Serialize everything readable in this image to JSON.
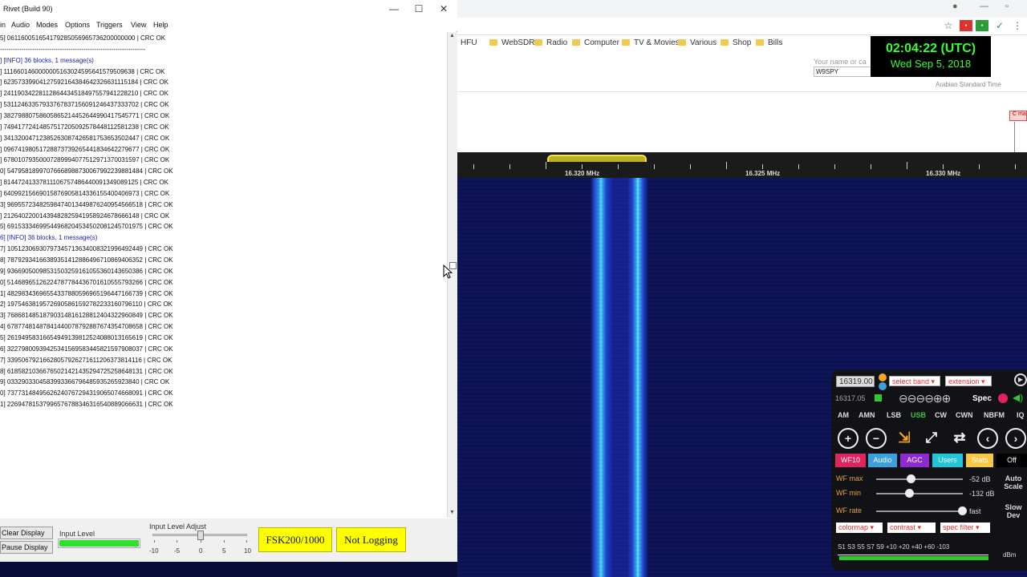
{
  "browser": {
    "bookmarks": [
      "HFU",
      "WebSDR",
      "Radio",
      "Computer",
      "TV & Movies",
      "Various",
      "Shop",
      "Bills"
    ],
    "name_label": "Your name or ca",
    "name_value": "W9SPY",
    "clock_time": "02:04:22 (UTC)",
    "clock_date": "Wed Sep 5, 2018",
    "timezone": "Arabian Standard Time",
    "c_button": "C ma",
    "freq_labels": [
      "16.320 MHz",
      "16.325 MHz",
      "16.330 MHz"
    ]
  },
  "panel": {
    "freq": "16319.00",
    "select_band": "select band",
    "extension": "extension",
    "sub_freq": "16317.05",
    "spec": "Spec",
    "modes": [
      "AM",
      "AMN",
      "LSB",
      "USB",
      "CW",
      "CWN",
      "NBFM",
      "IQ"
    ],
    "active_mode": "USB",
    "tags": {
      "wf10": "WF10",
      "audio": "Audio",
      "agc": "AGC",
      "users": "Users",
      "stats": "Stats",
      "off": "Off"
    },
    "wf_max": {
      "label": "WF max",
      "value": "-52 dB",
      "level": 0.4
    },
    "wf_min": {
      "label": "WF min",
      "value": "-132 dB",
      "level": 0.38
    },
    "wf_rate": {
      "label": "WF rate",
      "value": "fast",
      "level": 0.99
    },
    "auto_scale": [
      "Auto",
      "Scale"
    ],
    "slow_dev": [
      "Slow",
      "Dev"
    ],
    "colormap": "colormap",
    "contrast": "contrast",
    "spec_filter": "spec filter",
    "smeter_labels": "S1   S3   S5   S7   S9  +10 +20      +40      +60  -103",
    "smeter_unit": "dBm"
  },
  "rivet": {
    "title": "Rivet (Build 90)",
    "menu": [
      "in",
      "Audio",
      "Modes",
      "Options",
      "Triggers",
      "View",
      "Help"
    ],
    "log_lines": [
      {
        "text": "5] 061160051654179285056965736200000000 | CRC OK",
        "kind": "data"
      },
      {
        "text": "--------------------------------------------------------------------",
        "kind": "dash"
      },
      {
        "text": "] [INFO] 36 blocks, 1 message(s)",
        "kind": "info"
      },
      {
        "text": "] 111660146000000516302459564157950963​8 | CRC OK",
        "kind": "data"
      },
      {
        "text": "] 623573399041275921643846423266311151​84 | CRC OK",
        "kind": "data"
      },
      {
        "text": "] 241190342281128644345184975579412282​10 | CRC OK",
        "kind": "data"
      },
      {
        "text": "] 531124633579337678371560912464373337​02 | CRC OK",
        "kind": "data"
      },
      {
        "text": "] 382798807586058652144526449904175457​71 | CRC OK",
        "kind": "data"
      },
      {
        "text": "] 749417724148575172050925784481125812​38 | CRC OK",
        "kind": "data"
      },
      {
        "text": "] 341320047123852630874265817536535024​47 | CRC OK",
        "kind": "data"
      },
      {
        "text": "] 096741980517288737392654418346422796​77 | CRC OK",
        "kind": "data"
      },
      {
        "text": "] 678010793500072899940775129713700315​97 | CRC OK",
        "kind": "data"
      },
      {
        "text": "0] 5479581899707666898873006799223988148​4 | CRC OK",
        "kind": "data"
      },
      {
        "text": "] 8144724133781110675748644009134908912​5 | CRC OK",
        "kind": "data"
      },
      {
        "text": "] 6409921566901587690581433615540040697​3 | CRC OK",
        "kind": "data"
      },
      {
        "text": "3] 9695572348259847401344987624095456651​8 | CRC OK",
        "kind": "data"
      },
      {
        "text": "] 2126402200143948282594195892467866614​8 | CRC OK",
        "kind": "data"
      },
      {
        "text": "5] 6915333469954496820453450208124570197​5 | CRC OK",
        "kind": "data"
      },
      {
        "text": "6] [INFO] 36 blocks, 1 message(s)",
        "kind": "info"
      },
      {
        "text": "7] 1051230693079734571363400832199649244​9 | CRC OK",
        "kind": "data"
      },
      {
        "text": "8] 7879293416638935141288649671086940635​2 | CRC OK",
        "kind": "data"
      },
      {
        "text": "9] 9366905009853150325916105536014365038​6 | CRC OK",
        "kind": "data"
      },
      {
        "text": "0] 5146896512622478778443670161055579326​6 | CRC OK",
        "kind": "data"
      },
      {
        "text": "1] 4829834369655433788059696519644716673​9 | CRC OK",
        "kind": "data"
      },
      {
        "text": "2] 1975463819572690586159278223316079611​0 | CRC OK",
        "kind": "data"
      },
      {
        "text": "3] 7686814851879031481612881240432296084​9 | CRC OK",
        "kind": "data"
      },
      {
        "text": "4] 6787748148784144007879288767435470865​8 | CRC OK",
        "kind": "data"
      },
      {
        "text": "5] 2619495831665494913981252408801316561​9 | CRC OK",
        "kind": "data"
      },
      {
        "text": "6] 3227980093942534156958344582159790803​7 | CRC OK",
        "kind": "data"
      },
      {
        "text": "7] 3395067921662805792627161120637381411​6 | CRC OK",
        "kind": "data"
      },
      {
        "text": "8] 6185821036676502142143529472525864813​1 | CRC OK",
        "kind": "data"
      },
      {
        "text": "9] 0332903304583993366796485935265923840 | CRC OK",
        "kind": "data"
      },
      {
        "text": "0] 7377314849562624076729431906507466809​1 | CRC OK",
        "kind": "data"
      },
      {
        "text": "1] 2269478153799657678834631654088906663​1 | CRC OK",
        "kind": "data"
      }
    ],
    "clear_display": "Clear Display",
    "pause_display": "Pause Display",
    "input_level_label": "Input Level",
    "input_level": 1.0,
    "input_level_adjust_label": "Input Level Adjust",
    "input_level_adjust": 0,
    "adjust_ticks": [
      "-10",
      "-5",
      "0",
      "5",
      "10"
    ],
    "mode_button": "FSK200/1000",
    "logging_button": "Not Logging"
  }
}
